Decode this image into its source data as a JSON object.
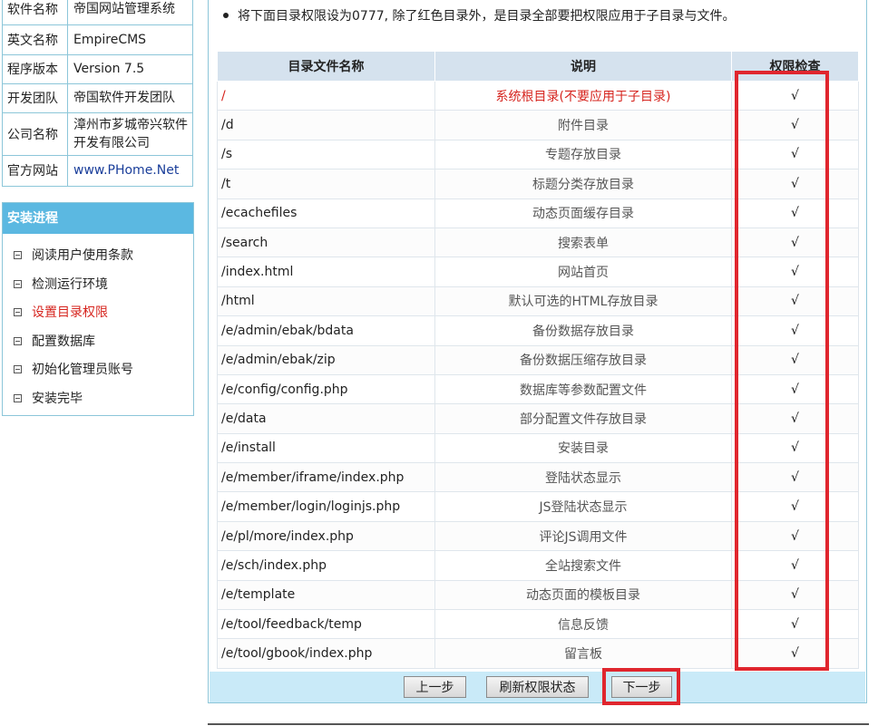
{
  "info": [
    {
      "key": "软件名称",
      "value": "帝国网站管理系统"
    },
    {
      "key": "英文名称",
      "value": "EmpireCMS"
    },
    {
      "key": "程序版本",
      "value": "Version 7.5"
    },
    {
      "key": "开发团队",
      "value": "帝国软件开发团队"
    },
    {
      "key": "公司名称",
      "value": "漳州市芗城帝兴软件开发有限公司"
    },
    {
      "key": "官方网站",
      "value": "www.PHome.Net"
    }
  ],
  "progress": {
    "title": "安装进程",
    "steps": [
      "阅读用户使用条款",
      "检测运行环境",
      "设置目录权限",
      "配置数据库",
      "初始化管理员账号",
      "安装完毕"
    ]
  },
  "notice": "将下面目录权限设为0777, 除了红色目录外，是目录全部要把权限应用于子目录与文件。",
  "table": {
    "headers": [
      "目录文件名称",
      "说明",
      "权限检查"
    ],
    "rows": [
      {
        "name": "/",
        "desc": "系统根目录(不要应用于子目录)",
        "check": "√"
      },
      {
        "name": "/d",
        "desc": "附件目录",
        "check": "√"
      },
      {
        "name": "/s",
        "desc": "专题存放目录",
        "check": "√"
      },
      {
        "name": "/t",
        "desc": "标题分类存放目录",
        "check": "√"
      },
      {
        "name": "/ecachefiles",
        "desc": "动态页面缓存目录",
        "check": "√"
      },
      {
        "name": "/search",
        "desc": "搜索表单",
        "check": "√"
      },
      {
        "name": "/index.html",
        "desc": "网站首页",
        "check": "√"
      },
      {
        "name": "/html",
        "desc": "默认可选的HTML存放目录",
        "check": "√"
      },
      {
        "name": "/e/admin/ebak/bdata",
        "desc": "备份数据存放目录",
        "check": "√"
      },
      {
        "name": "/e/admin/ebak/zip",
        "desc": "备份数据压缩存放目录",
        "check": "√"
      },
      {
        "name": "/e/config/config.php",
        "desc": "数据库等参数配置文件",
        "check": "√"
      },
      {
        "name": "/e/data",
        "desc": "部分配置文件存放目录",
        "check": "√"
      },
      {
        "name": "/e/install",
        "desc": "安装目录",
        "check": "√"
      },
      {
        "name": "/e/member/iframe/index.php",
        "desc": "登陆状态显示",
        "check": "√"
      },
      {
        "name": "/e/member/login/loginjs.php",
        "desc": "JS登陆状态显示",
        "check": "√"
      },
      {
        "name": "/e/pl/more/index.php",
        "desc": "评论JS调用文件",
        "check": "√"
      },
      {
        "name": "/e/sch/index.php",
        "desc": "全站搜索文件",
        "check": "√"
      },
      {
        "name": "/e/template",
        "desc": "动态页面的模板目录",
        "check": "√"
      },
      {
        "name": "/e/tool/feedback/temp",
        "desc": "信息反馈",
        "check": "√"
      },
      {
        "name": "/e/tool/gbook/index.php",
        "desc": "留言板",
        "check": "√"
      }
    ]
  },
  "buttons": {
    "prev": "上一步",
    "refresh": "刷新权限状态",
    "next": "下一步"
  },
  "colors": {
    "accent": "#5bb8e1",
    "highlight": "#e0262e",
    "active_step": "#d6241e"
  }
}
